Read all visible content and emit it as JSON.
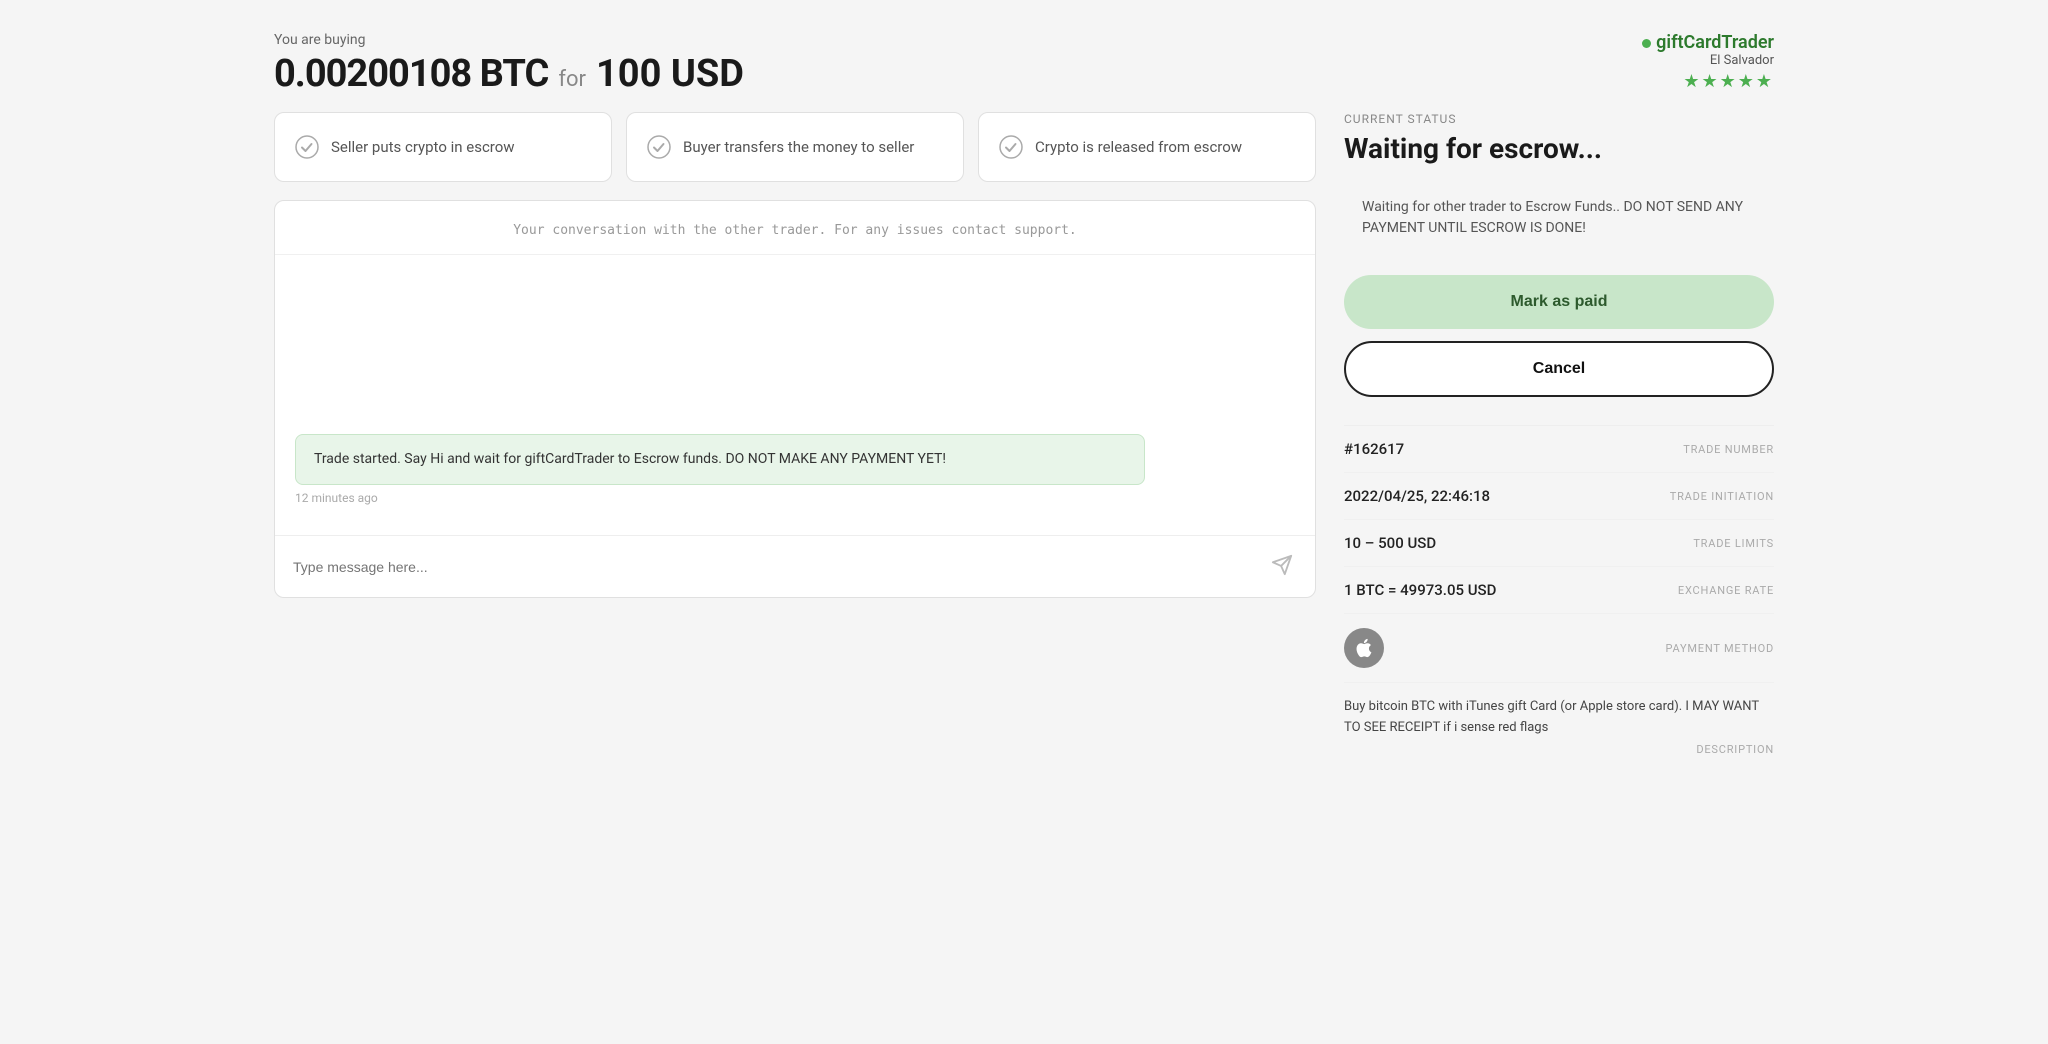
{
  "header": {
    "buying_label": "You are buying",
    "btc_amount": "0.00200108 BTC",
    "for_text": "for",
    "usd_amount": "100 USD"
  },
  "trader": {
    "name": "giftCardTrader",
    "location": "El Salvador",
    "stars": "★★★★★"
  },
  "steps": [
    {
      "id": "step1",
      "text": "Seller puts crypto in escrow"
    },
    {
      "id": "step2",
      "text": "Buyer transfers the money to seller"
    },
    {
      "id": "step3",
      "text": "Crypto is released from escrow"
    }
  ],
  "chat": {
    "header_text": "Your conversation with the other trader. For any issues contact support.",
    "message_text": "Trade started. Say Hi and wait for giftCardTrader to Escrow funds. DO NOT MAKE ANY PAYMENT YET!",
    "message_time": "12 minutes ago",
    "input_placeholder": "Type message here...",
    "send_icon": "➤"
  },
  "status": {
    "label": "CURRENT STATUS",
    "title": "Waiting for escrow...",
    "warning": "Waiting for other trader to Escrow Funds.. DO NOT SEND ANY PAYMENT UNTIL ESCROW IS DONE!"
  },
  "buttons": {
    "mark_paid": "Mark as paid",
    "cancel": "Cancel"
  },
  "trade_details": {
    "trade_number_value": "#162617",
    "trade_number_label": "TRADE NUMBER",
    "trade_initiation_value": "2022/04/25, 22:46:18",
    "trade_initiation_label": "TRADE INITIATION",
    "trade_limits_value": "10 – 500 USD",
    "trade_limits_label": "TRADE LIMITS",
    "exchange_rate_value": "1 BTC = 49973.05 USD",
    "exchange_rate_label": "EXCHANGE RATE",
    "payment_method_label": "PAYMENT METHOD",
    "description_text": "Buy bitcoin BTC with iTunes gift Card (or Apple store card). I MAY WANT TO SEE RECEIPT if i sense red flags",
    "description_label": "DESCRIPTION"
  }
}
